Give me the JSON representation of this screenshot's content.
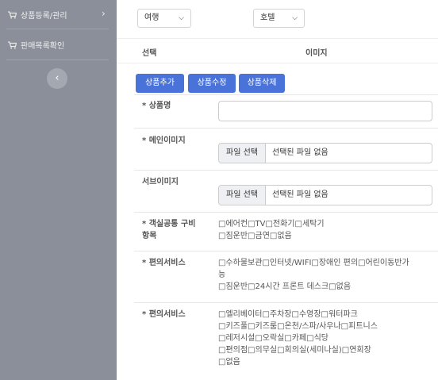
{
  "sidebar": {
    "items": [
      {
        "label": "상품등록/관리"
      },
      {
        "label": "판매목록확인"
      }
    ]
  },
  "filters": {
    "select1": "여행",
    "select2": "호텔"
  },
  "table_header": {
    "col1": "선택",
    "col2": "이미지"
  },
  "actions": {
    "add": "상품추가",
    "edit": "상품수정",
    "delete": "상품삭제"
  },
  "form": {
    "product_name_label": "* 상품명",
    "main_image_label": "* 메인이미지",
    "sub_image_label": "서브이미지",
    "file_button": "파일 선택",
    "file_status": "선택된 파일 없음",
    "room_amenities_label_1": "* 객실공통 구비",
    "room_amenities_label_2": "항목",
    "room_amenities_line1": "□에어컨□TV□전화기□세탁기",
    "room_amenities_line2": "□짐운반□금연□없음",
    "services1_label": "* 편의서비스",
    "services1_line1": "□수하물보관□인터넷/WIFI□장애인 편의□어린이동반가",
    "services1_line2": "능",
    "services1_line3": "□짐운반□24시간 프론트 데스크□없음",
    "services2_label": "* 편의서비스",
    "services2_line1": "□엘리베이터□주차장□수영장□워터파크",
    "services2_line2": "□키즈풀□키즈룸□온천/스파/사우나□피트니스",
    "services2_line3": "□레저시설□오락실□카페□식당",
    "services2_line4": "□편의점□의무실□회의실(세미나실)□연회장",
    "services2_line5": "□없음"
  }
}
